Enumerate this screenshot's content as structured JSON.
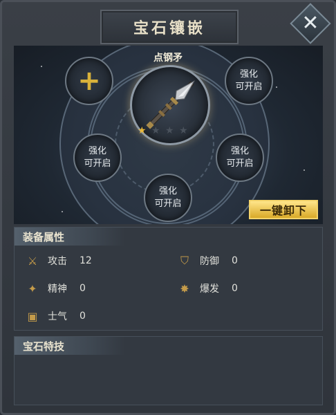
{
  "window": {
    "title": "宝石镶嵌",
    "close_icon": "close-x-icon"
  },
  "equipment": {
    "name": "点钢矛",
    "icon": "spear-icon",
    "stars": {
      "filled": 1,
      "total": 4
    }
  },
  "gem_slots": [
    {
      "id": "top-left",
      "type": "add",
      "icon": "plus-icon"
    },
    {
      "id": "top-right",
      "line1": "强化",
      "line2": "可开启"
    },
    {
      "id": "mid-left",
      "line1": "强化",
      "line2": "可开启"
    },
    {
      "id": "mid-right",
      "line1": "强化",
      "line2": "可开启"
    },
    {
      "id": "bottom",
      "line1": "强化",
      "line2": "可开启"
    }
  ],
  "actions": {
    "unload_all": "一键卸下"
  },
  "attributes": {
    "title": "装备属性",
    "stats": [
      {
        "name": "攻击",
        "value": "12",
        "icon": "crossed-swords-icon"
      },
      {
        "name": "防御",
        "value": "0",
        "icon": "shield-icon"
      },
      {
        "name": "精神",
        "value": "0",
        "icon": "spirit-icon"
      },
      {
        "name": "爆发",
        "value": "0",
        "icon": "burst-icon"
      },
      {
        "name": "士气",
        "value": "0",
        "icon": "morale-icon"
      }
    ]
  },
  "gem_skills": {
    "title": "宝石特技"
  },
  "colors": {
    "accent_gold": "#d9b23a",
    "button_gold": "#f3c84f"
  }
}
